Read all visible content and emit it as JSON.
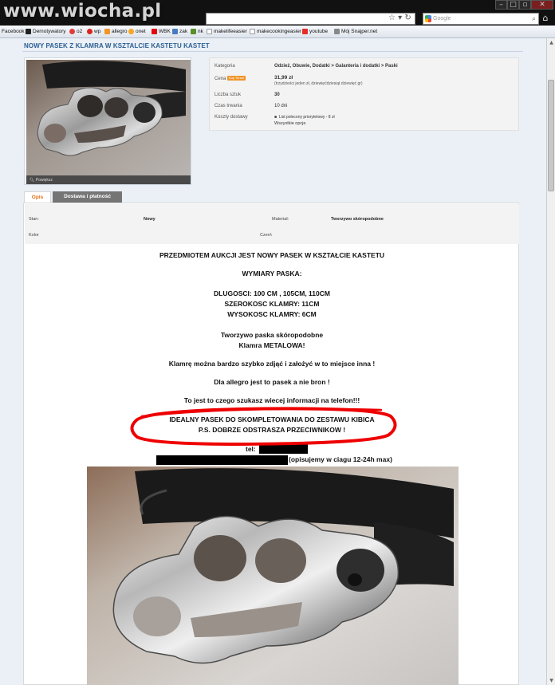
{
  "watermark": "www.wiocha.pl",
  "search": {
    "placeholder": "Google"
  },
  "bookmarks": [
    {
      "label": "Facebook",
      "color": "#3b5998"
    },
    {
      "label": "Demotywatory",
      "color": "#222222"
    },
    {
      "label": "o2",
      "color": "#e23b3b"
    },
    {
      "label": "wp",
      "color": "#d9261c"
    },
    {
      "label": "allegro",
      "color": "#f0952a"
    },
    {
      "label": "onet",
      "color": "#f5a623"
    },
    {
      "label": "WBK",
      "color": "#e30613"
    },
    {
      "label": "zak",
      "color": "#4a7cc0"
    },
    {
      "label": "nk",
      "color": "#5a8f2a"
    },
    {
      "label": "makelifeeasier",
      "color": "#cccccc"
    },
    {
      "label": "makecookingeasier",
      "color": "#cccccc"
    },
    {
      "label": "youtube",
      "color": "#e52d27"
    },
    {
      "label": "Mój Snajper.net",
      "color": "#888888"
    }
  ],
  "page": {
    "title": "NOWY PASEK Z KLAMRA W KSZTALCIE KASTETU KASTET",
    "zoom_label": "Powiększ"
  },
  "info": {
    "kategoria_label": "Kategoria",
    "kategoria_value": "Odzież, Obuwie, Dodatki > Galanteria i dodatki > Paski",
    "cena_label": "Cena",
    "cena_badge": "Kup Teraz!",
    "cena_value": "31,99 zł",
    "cena_words": "(trzydzieści jeden zł, dziewięćdziesiąt dziewięć gr)",
    "sztuk_label": "Liczba sztuk",
    "sztuk_value": "30",
    "czas_label": "Czas trwania",
    "czas_value": "10 dni",
    "koszty_label": "Koszty dostawy",
    "koszty_value": "List polecony priorytetowy - 8 zł",
    "koszty_link": "Wszystkie opcje"
  },
  "tabs": {
    "opis": "Opis",
    "dostawa": "Dostawa i płatność"
  },
  "params": {
    "stan_label": "Stan:",
    "stan_value": "Nowy",
    "material_label": "Materiał:",
    "material_value": "Tworzywo skóropodobne",
    "kolor_label": "Kolor",
    "czern_label": "Czerń"
  },
  "description": {
    "line1": "PRZEDMIOTEM AUKCJI JEST NOWY PASEK W KSZTAŁCIE KASTETU",
    "line2": "WYMIARY PASKA:",
    "line3": "DLUGOSCI: 100 CM , 105CM, 110CM",
    "line4": "SZEROKOSC KLAMRY: 11CM",
    "line5": "WYSOKOSC KLAMRY: 6CM",
    "line6": "Tworzywo paska skóropodobne",
    "line7": "Klamra METALOWA!",
    "line8": "Klamrę można bardzo szybko zdjąć i założyć w to miejsce inna !",
    "line9": "Dla allegro jest to pasek a nie bron !",
    "line10": "To jest to czego szukasz wiecej informacji na telefon!!!",
    "line11": "IDEALNY PASEK DO SKOMPLETOWANIA DO ZESTAWU KIBICA",
    "line12": "P.S. DOBRZE ODSTRASZA PRZECIWNIKOW !",
    "tel_label": "tel:",
    "reply_note": "(opisujemy w ciagu 12-24h max)"
  }
}
